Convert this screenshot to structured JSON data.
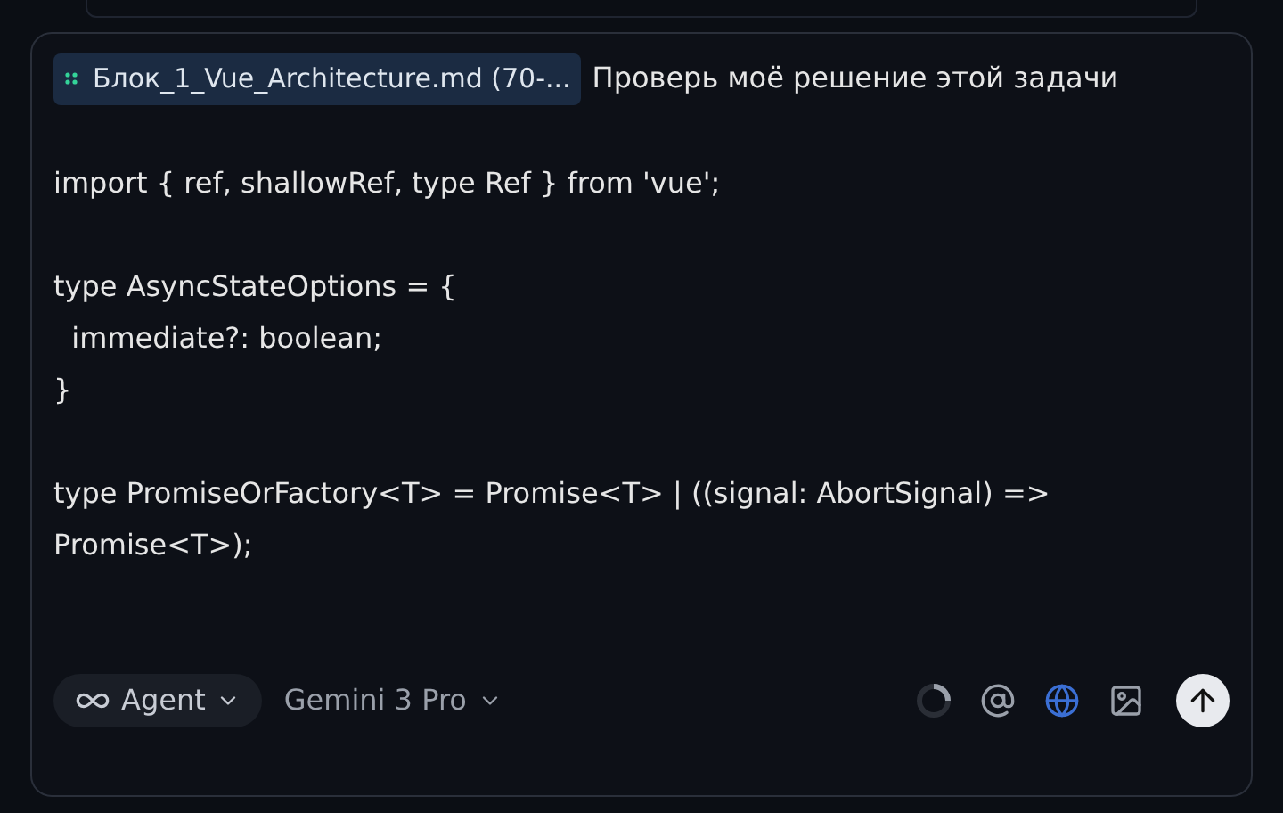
{
  "composer": {
    "attachment": {
      "name": "Блок_1_Vue_Architecture.md (70-..."
    },
    "message_blocks": [
      [
        "Проверь моё решение этой задачи"
      ],
      [
        "import { ref, shallowRef, type Ref } from 'vue';"
      ],
      [
        "type AsyncStateOptions = {",
        "  immediate?: boolean;",
        "}"
      ],
      [
        "type PromiseOrFactory<T> = Promise<T> | ((signal: AbortSignal) => Promise<T>);"
      ]
    ],
    "mode": {
      "label": "Agent"
    },
    "model": {
      "label": "Gemini 3 Pro"
    }
  }
}
